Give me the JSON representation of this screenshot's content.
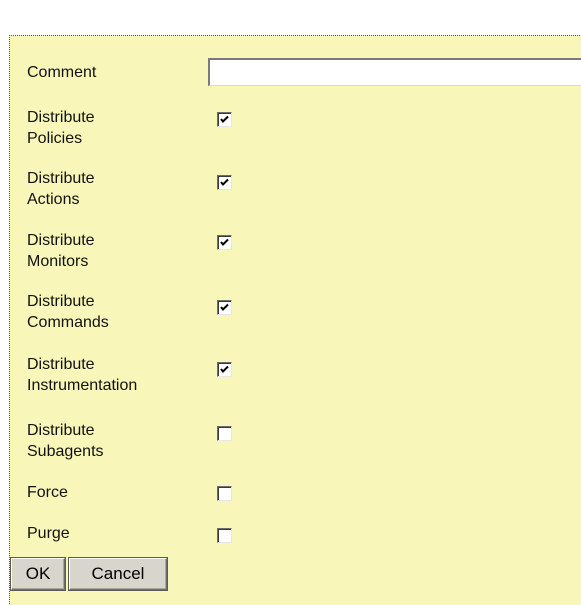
{
  "header": {
    "partial_title": ""
  },
  "form": {
    "comment": {
      "label": "Comment",
      "value": "",
      "placeholder": ""
    },
    "options": [
      {
        "label": "Distribute\nPolicies",
        "checked": true
      },
      {
        "label": "Distribute\nActions",
        "checked": true
      },
      {
        "label": "Distribute\nMonitors",
        "checked": true
      },
      {
        "label": "Distribute\nCommands",
        "checked": true
      },
      {
        "label": "Distribute\nInstrumentation",
        "checked": true
      },
      {
        "label": "Distribute\nSubagents",
        "checked": false
      },
      {
        "label": "Force",
        "checked": false
      },
      {
        "label": "Purge",
        "checked": false
      }
    ]
  },
  "buttons": {
    "ok_label": "OK",
    "cancel_label": "Cancel"
  },
  "colors": {
    "panel_background": "#f8f6b9",
    "button_face": "#d8d5cc"
  },
  "icons": {
    "checkbox_mark": "checkmark-icon"
  }
}
